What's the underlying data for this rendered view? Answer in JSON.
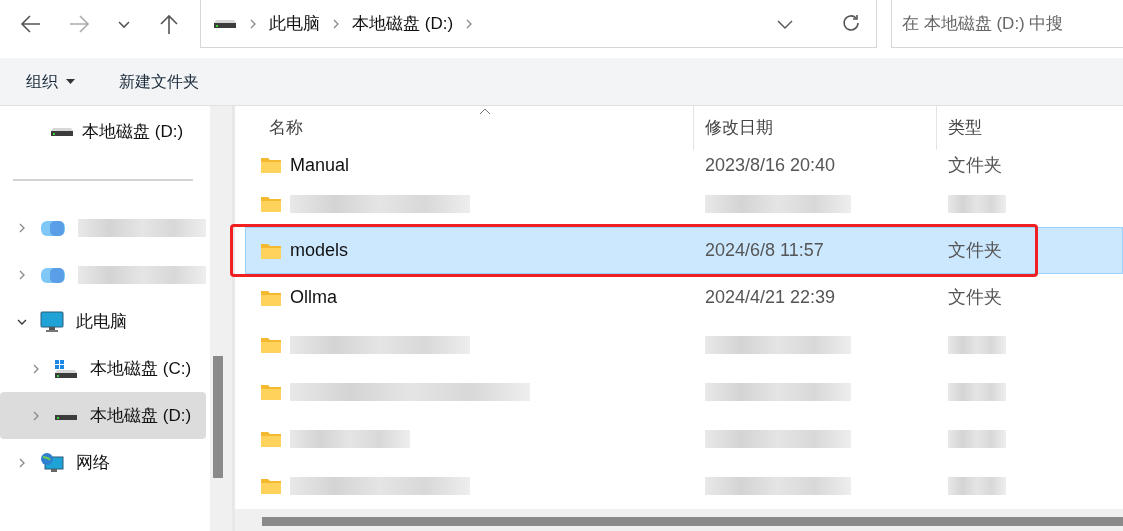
{
  "nav": {
    "back_disabled": false,
    "forward_disabled": true
  },
  "address": {
    "crumbs": [
      "此电脑",
      "本地磁盘 (D:)"
    ]
  },
  "search": {
    "placeholder": "在 本地磁盘 (D:) 中搜"
  },
  "toolbar": {
    "organize": "组织",
    "new_folder": "新建文件夹"
  },
  "sidebar": {
    "pinned": [
      {
        "label": "本地磁盘 (D:)"
      }
    ],
    "tree": [
      {
        "kind": "redacted",
        "expanded": false,
        "selected": false
      },
      {
        "kind": "redacted",
        "expanded": false,
        "selected": false
      },
      {
        "kind": "item",
        "label": "此电脑",
        "expanded": true,
        "selected": false,
        "children": [
          {
            "kind": "item",
            "label": "本地磁盘 (C:)",
            "expanded": false,
            "selected": false
          },
          {
            "kind": "item",
            "label": "本地磁盘 (D:)",
            "expanded": false,
            "selected": true
          }
        ]
      },
      {
        "kind": "item",
        "label": "网络",
        "expanded": false,
        "selected": false
      }
    ]
  },
  "table": {
    "columns": [
      "名称",
      "修改日期",
      "类型"
    ],
    "rows": [
      {
        "kind": "file",
        "name": "Manual",
        "date": "2023/8/16 20:40",
        "type": "文件夹",
        "selected": false,
        "highlighted": false
      },
      {
        "kind": "redacted",
        "selected": false,
        "highlighted": false
      },
      {
        "kind": "file",
        "name": "models",
        "date": "2024/6/8 11:57",
        "type": "文件夹",
        "selected": true,
        "highlighted": true
      },
      {
        "kind": "file",
        "name": "Ollma",
        "date": "2024/4/21 22:39",
        "type": "文件夹",
        "selected": false,
        "highlighted": false
      },
      {
        "kind": "redacted",
        "selected": false,
        "highlighted": false
      },
      {
        "kind": "redacted",
        "selected": false,
        "highlighted": false
      },
      {
        "kind": "redacted",
        "selected": false,
        "highlighted": false
      },
      {
        "kind": "redacted",
        "selected": false,
        "highlighted": false
      }
    ]
  }
}
